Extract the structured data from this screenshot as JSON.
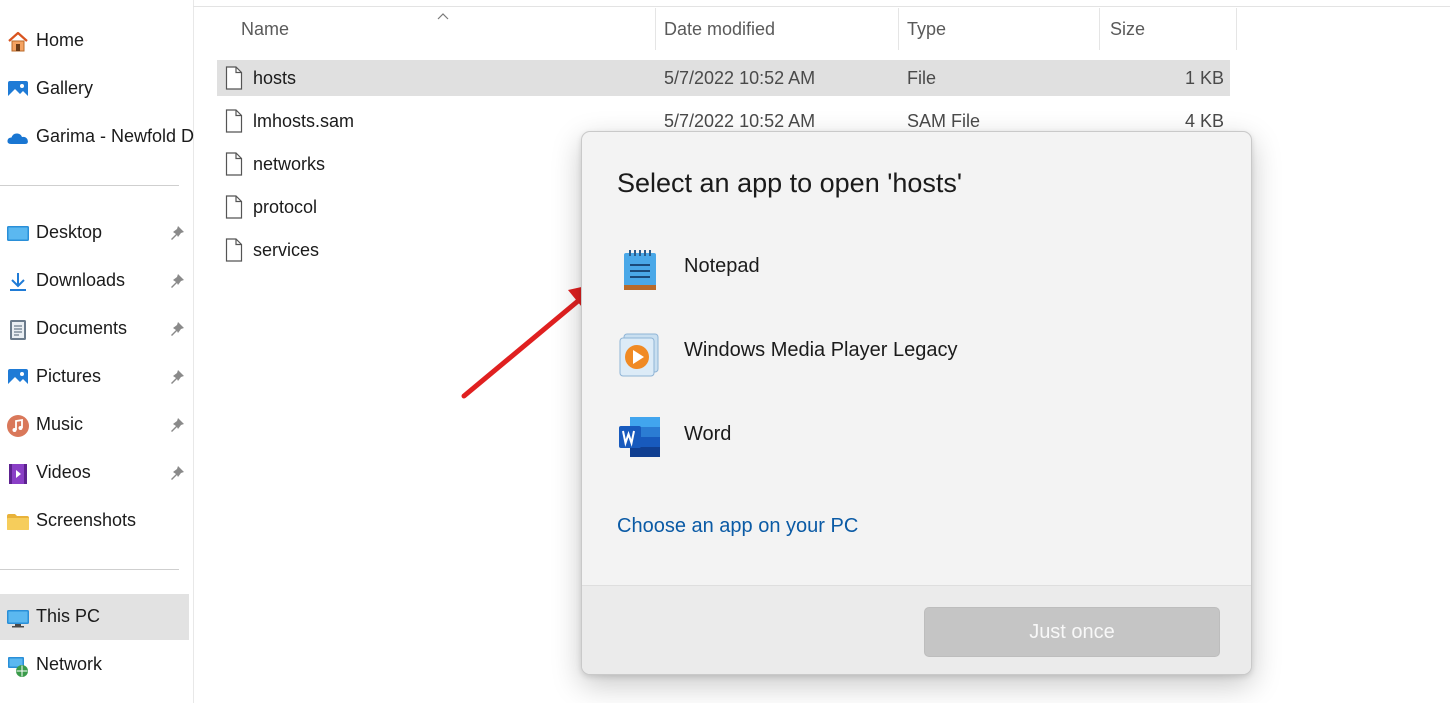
{
  "sidebar": {
    "quick": [
      {
        "label": "Home",
        "icon": "home-icon"
      },
      {
        "label": "Gallery",
        "icon": "gallery-icon"
      },
      {
        "label": "Garima - Newfold D",
        "icon": "onedrive-cloud-icon"
      }
    ],
    "pinned": [
      {
        "label": "Desktop",
        "icon": "desktop-icon"
      },
      {
        "label": "Downloads",
        "icon": "downloads-icon"
      },
      {
        "label": "Documents",
        "icon": "documents-icon"
      },
      {
        "label": "Pictures",
        "icon": "pictures-icon"
      },
      {
        "label": "Music",
        "icon": "music-icon"
      },
      {
        "label": "Videos",
        "icon": "videos-icon"
      },
      {
        "label": "Screenshots",
        "icon": "folder-icon"
      }
    ],
    "devices": [
      {
        "label": "This PC",
        "icon": "this-pc-icon",
        "selected": true
      },
      {
        "label": "Network",
        "icon": "network-icon"
      }
    ]
  },
  "file_list": {
    "columns": {
      "name": "Name",
      "date": "Date modified",
      "type": "Type",
      "size": "Size"
    },
    "files": [
      {
        "name": "hosts",
        "date": "5/7/2022 10:52 AM",
        "type": "File",
        "size": "1 KB",
        "selected": true
      },
      {
        "name": "lmhosts.sam",
        "date": "5/7/2022 10:52 AM",
        "type": "SAM File",
        "size": "4 KB"
      },
      {
        "name": "networks",
        "date": "",
        "type": "",
        "size": ""
      },
      {
        "name": "protocol",
        "date": "",
        "type": "",
        "size": ""
      },
      {
        "name": "services",
        "date": "",
        "type": "",
        "size": ""
      }
    ]
  },
  "dialog": {
    "title": "Select an app to open 'hosts'",
    "apps": [
      {
        "label": "Notepad",
        "icon": "notepad-icon"
      },
      {
        "label": "Windows Media Player Legacy",
        "icon": "media-player-icon"
      },
      {
        "label": "Word",
        "icon": "word-icon"
      }
    ],
    "choose_link": "Choose an app on your PC",
    "just_once": "Just once"
  },
  "colors": {
    "accent_link": "#0a5aa5",
    "annotation_arrow": "#e02020",
    "selected_row": "#e0e0e0",
    "disabled_button": "#c5c5c5"
  }
}
